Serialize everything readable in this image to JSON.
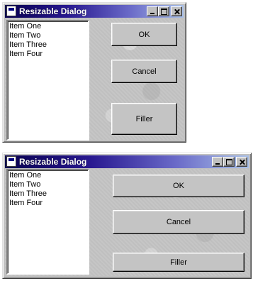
{
  "colors": {
    "titlebar_start": "#080050",
    "titlebar_end": "#a8c0e8",
    "face": "#c0c0c0"
  },
  "dialogs": [
    {
      "title": "Resizable Dialog",
      "title_buttons": [
        "minimize-icon",
        "maximize-icon",
        "close-icon"
      ],
      "list_items": [
        "Item One",
        "Item Two",
        "Item Three",
        "Item Four"
      ],
      "buttons": {
        "ok": "OK",
        "cancel": "Cancel",
        "filler": "Filler"
      }
    },
    {
      "title": "Resizable Dialog",
      "title_buttons": [
        "minimize-icon",
        "maximize-icon",
        "close-icon"
      ],
      "list_items": [
        "Item One",
        "Item Two",
        "Item Three",
        "Item Four"
      ],
      "buttons": {
        "ok": "OK",
        "cancel": "Cancel",
        "filler": "Filler"
      }
    }
  ]
}
